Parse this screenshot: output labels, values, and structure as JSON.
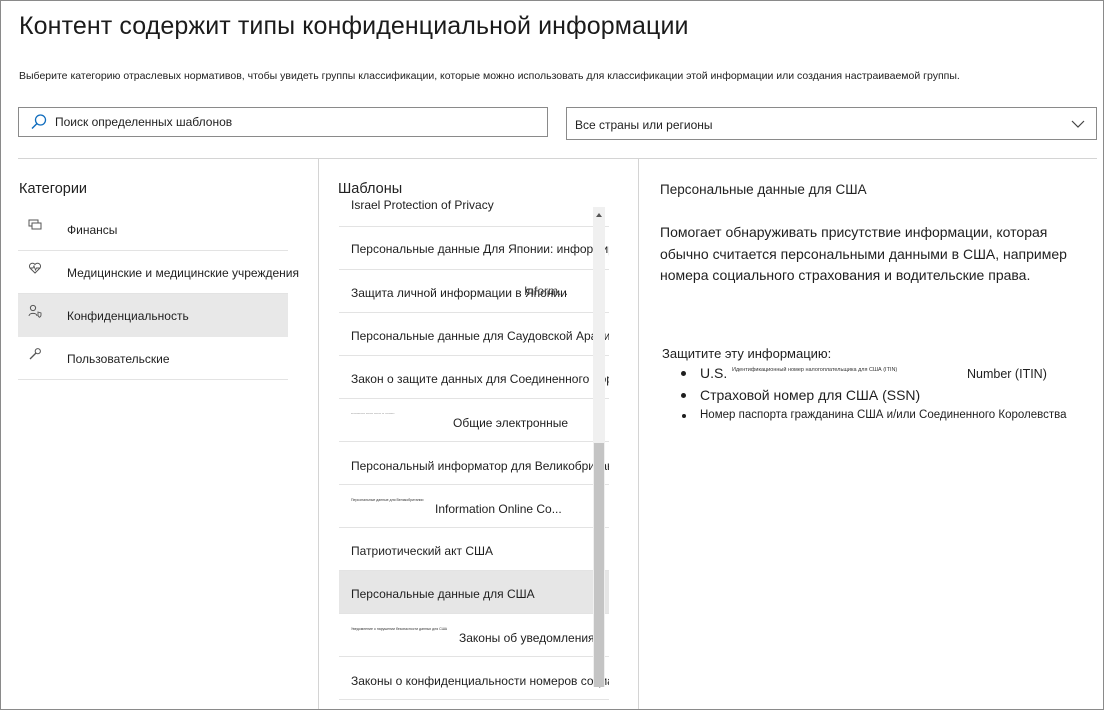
{
  "header": {
    "title": "Контент содержит типы конфиденциальной информации",
    "subtitle": "Выберите категорию отраслевых нормативов, чтобы увидеть группы классификации, которые можно использовать для классификации этой информации или создания настраиваемой группы."
  },
  "search": {
    "placeholder": "Поиск определенных шаблонов",
    "icon": "search-icon"
  },
  "region": {
    "selected": "Все страны или регионы",
    "icon": "chevron-down-icon"
  },
  "categories": {
    "heading": "Категории",
    "items": [
      {
        "label": "Финансы",
        "icon": "finance-icon"
      },
      {
        "label": "Медицинские и медицинские учреждения",
        "icon": "heart-icon"
      },
      {
        "label": "Конфиденциальность",
        "icon": "person-shield-icon",
        "selected": true
      },
      {
        "label": "Пользовательские",
        "icon": "wrench-icon"
      }
    ]
  },
  "templates": {
    "heading": "Шаблоны",
    "items": [
      {
        "label": "Israel Protection of Privacy"
      },
      {
        "label": "Персональные данные Для Японии: информирование..."
      },
      {
        "label": "Защита личной информации в Японии",
        "overlay": "Inform..."
      },
      {
        "label": "Персональные данные для Саудовской Аравии"
      },
      {
        "label": "Закон о защите данных для Соединенного Королевства"
      },
      {
        "tiny": "------------ ------ ------ -- --------",
        "label": "Общие электронные"
      },
      {
        "label": "Персональный информатор для Великобритании"
      },
      {
        "tiny": "Персональные данные для Великобритании",
        "label": "Information Online Co..."
      },
      {
        "label": "Патриотический акт США"
      },
      {
        "label": "Персональные данные для США",
        "selected": true
      },
      {
        "tiny": "Уведомление о нарушении безопасности данных для США",
        "label": "Законы об уведомлениях"
      },
      {
        "label": "Законы о конфиденциальности номеров социального страхования США"
      }
    ]
  },
  "details": {
    "title": "Персональные данные для США",
    "description": "Помогает обнаруживать присутствие информации, которая обычно считается персональными данными в США, например номера социального страхования и водительские права.",
    "protect_label": "Защитите эту информацию:",
    "items": [
      {
        "prefix": "U.S.",
        "tiny": "Идентификационный номер налогоплательщика для США (ITIN)",
        "suffix": "Number (ITIN)"
      },
      {
        "label": "Страховой номер для США (SSN)"
      },
      {
        "label": "Номер паспорта гражданина США и/или Соединенного Королевства"
      }
    ]
  }
}
